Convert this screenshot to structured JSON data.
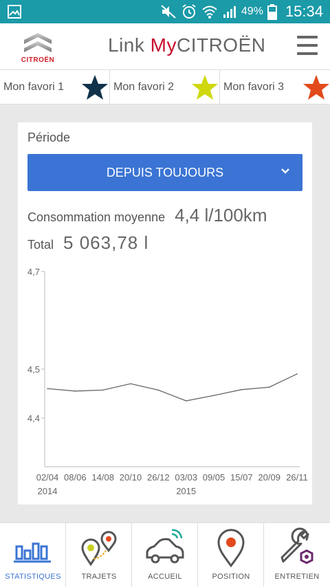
{
  "status_bar": {
    "battery_pct": "49%",
    "time": "15:34",
    "icons": [
      "gallery-icon",
      "mute-icon",
      "alarm-icon",
      "wifi-icon",
      "signal-icon",
      "battery-icon"
    ]
  },
  "header": {
    "logo_text": "CITROËN",
    "title_prefix": "Link ",
    "title_accent": "My",
    "title_suffix": "CITROËN",
    "accent_color": "#c8102e"
  },
  "favorites": [
    {
      "label": "Mon favori 1",
      "star_color": "#10324a"
    },
    {
      "label": "Mon favori 2",
      "star_color": "#cfd80e"
    },
    {
      "label": "Mon favori 3",
      "star_color": "#e24a1c"
    }
  ],
  "stats": {
    "period_label": "Période",
    "period_value": "DEPUIS TOUJOURS",
    "conso_label": "Consommation moyenne",
    "conso_value": "4,4 l/100km",
    "total_label": "Total",
    "total_value": "5 063,78 l",
    "select_color": "#3b74d4"
  },
  "chart_data": {
    "type": "line",
    "title": "",
    "xlabel": "",
    "ylabel": "",
    "y_ticks": [
      "4,7",
      "4,5",
      "4,4"
    ],
    "ylim": [
      4.3,
      4.7
    ],
    "x_ticks": [
      "02/04",
      "08/06",
      "14/08",
      "20/10",
      "26/12",
      "03/03",
      "09/05",
      "15/07",
      "20/09",
      "26/11"
    ],
    "year_labels": [
      {
        "at": "02/04",
        "year": "2014"
      },
      {
        "at": "03/03",
        "year": "2015"
      }
    ],
    "x": [
      "02/04",
      "08/06",
      "14/08",
      "20/10",
      "26/12",
      "03/03",
      "09/05",
      "15/07",
      "20/09",
      "26/11"
    ],
    "values": [
      4.46,
      4.455,
      4.457,
      4.47,
      4.457,
      4.435,
      4.446,
      4.458,
      4.463,
      4.49
    ],
    "grid": false,
    "line_color": "#666666"
  },
  "nav": [
    {
      "label": "STATISTIQUES",
      "icon": "bar-chart-icon",
      "active": true
    },
    {
      "label": "TRAJETS",
      "icon": "route-pins-icon",
      "active": false
    },
    {
      "label": "ACCUEIL",
      "icon": "connected-car-icon",
      "active": false
    },
    {
      "label": "POSITION",
      "icon": "map-pin-icon",
      "active": false
    },
    {
      "label": "ENTRETIEN",
      "icon": "wrench-icon",
      "active": false
    }
  ]
}
